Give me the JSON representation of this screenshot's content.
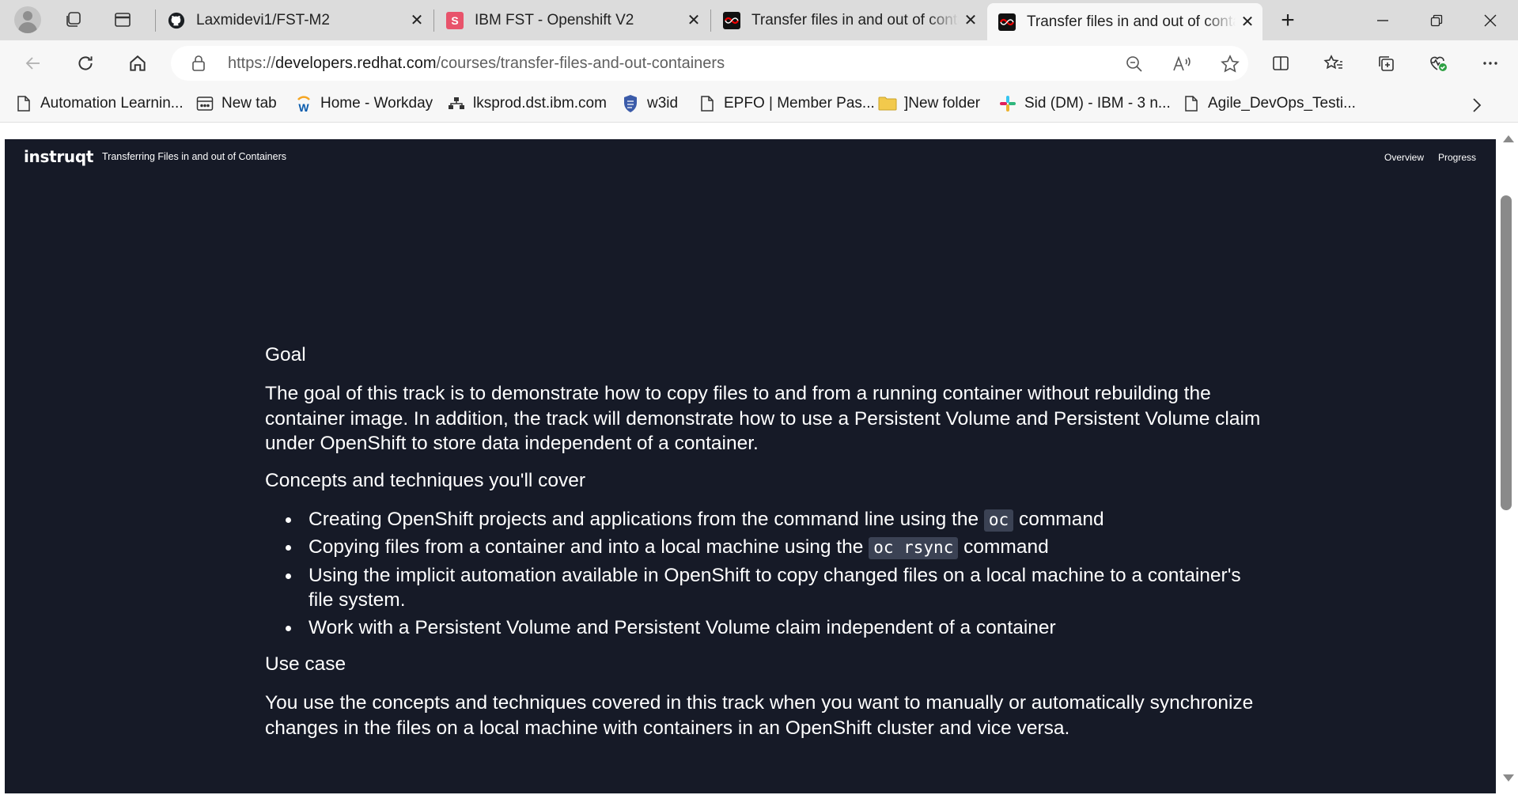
{
  "browser": {
    "tabs": [
      {
        "title": "Laxmidevi1/FST-M2",
        "favicon": "github-icon"
      },
      {
        "title": "IBM FST - Openshift V2",
        "favicon": "s-app-icon"
      },
      {
        "title": "Transfer files in and out of containers",
        "favicon": "redhat-developer-icon"
      },
      {
        "title": "Transfer files in and out of containers",
        "favicon": "redhat-developer-icon",
        "active": true
      }
    ],
    "url": {
      "scheme": "https://",
      "host": "developers.redhat.com",
      "path": "/courses/transfer-files-and-out-containers"
    },
    "bookmarks": [
      {
        "label": "Automation Learnin...",
        "icon": "page-icon"
      },
      {
        "label": "New tab",
        "icon": "newtab-icon"
      },
      {
        "label": "Home - Workday",
        "icon": "workday-icon"
      },
      {
        "label": "lksprod.dst.ibm.com",
        "icon": "network-icon"
      },
      {
        "label": "w3id",
        "icon": "shield-icon"
      },
      {
        "label": "EPFO | Member Pas...",
        "icon": "page-icon"
      },
      {
        "label": "]New folder",
        "icon": "folder-icon"
      },
      {
        "label": "Sid (DM) - IBM - 3 n...",
        "icon": "slack-icon"
      },
      {
        "label": "Agile_DevOps_Testi...",
        "icon": "page-icon"
      }
    ],
    "colors": {
      "tabstrip": "#dcdcdc",
      "toolbar": "#f7f7f7",
      "accent": "#e00"
    }
  },
  "app": {
    "logo": "instruqt",
    "track_title": "Transferring Files in and out of Containers",
    "nav": {
      "overview": "Overview",
      "progress": "Progress"
    },
    "background": "#161a27"
  },
  "content": {
    "goal_heading": "Goal",
    "goal_text": "The goal of this track is to demonstrate how to copy files to and from a running container without rebuilding the container image. In addition, the track will demonstrate how to use a Persistent Volume and Persistent Volume claim under OpenShift to store data independent of a container.",
    "concepts_heading": "Concepts and techniques you'll cover",
    "concepts": {
      "item1_pre": "Creating OpenShift projects and applications from the command line using the ",
      "item1_code": "oc",
      "item1_post": " command",
      "item2_pre": "Copying files from a container and into a local machine using the ",
      "item2_code": "oc rsync",
      "item2_post": " command",
      "item3": "Using the implicit automation available in OpenShift to copy changed files on a local machine to a container's file system.",
      "item4": "Work with a Persistent Volume and Persistent Volume claim independent of a container"
    },
    "usecase_heading": "Use case",
    "usecase_text": "You use the concepts and techniques covered in this track when you want to manually or automatically synchronize changes in the files on a local machine with containers in an OpenShift cluster and vice versa."
  }
}
